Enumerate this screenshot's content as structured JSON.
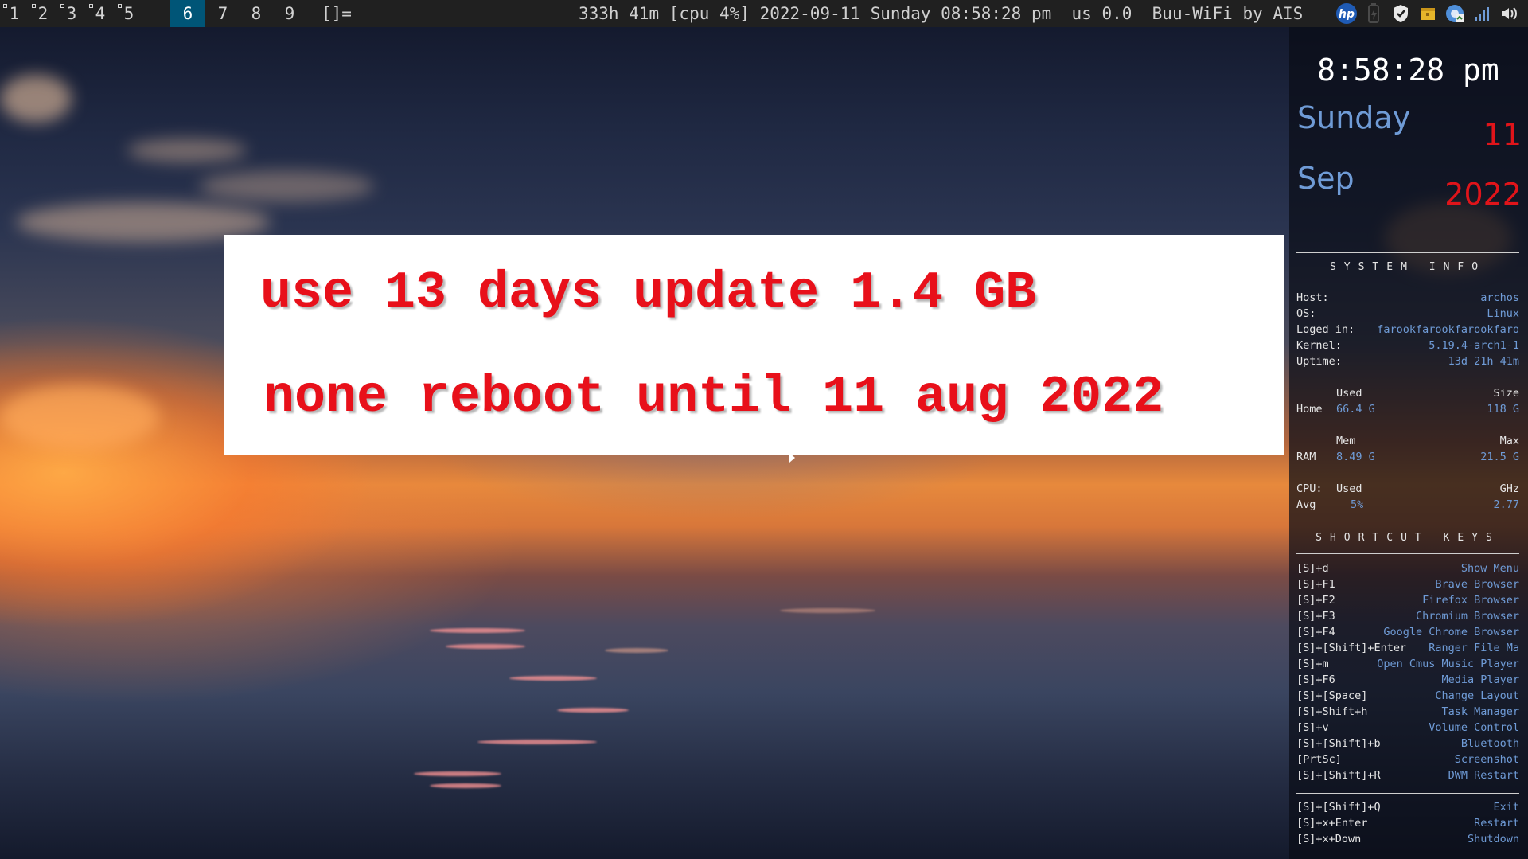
{
  "topbar": {
    "tags": [
      "1",
      "2",
      "3",
      "4",
      "5",
      "6",
      "7",
      "8",
      "9"
    ],
    "active_tag": "6",
    "layout_symbol": "[]=",
    "status_text": "333h 41m [cpu 4%] 2022-09-11 Sunday 08:58:28 pm  us 0.0  Buu-WiFi by AIS",
    "tray_icons": [
      "hp-icon",
      "battery-icon",
      "shield-icon",
      "package-icon",
      "chrome-update-icon",
      "signal-icon",
      "volume-icon"
    ],
    "hp_label": "hp"
  },
  "notice": {
    "line1": "use 13 days update 1.4 GB",
    "line2": "none reboot until 11 aug 2022"
  },
  "conky": {
    "clock": "8:58:28 pm",
    "day_name": "Sunday",
    "day_num": "11",
    "month": "Sep",
    "year": "2022",
    "system_info_title": "SYSTEM  INFO",
    "host_label": "Host:",
    "host_value": "archos",
    "os_label": "OS:",
    "os_value": "Linux",
    "login_label": "Loged in:",
    "login_value": "farookfarookfarookfaro",
    "kernel_label": "Kernel:",
    "kernel_value": "5.19.4-arch1-1",
    "uptime_label": "Uptime:",
    "uptime_value": "13d 21h 41m",
    "disk_used_header": "Used",
    "disk_size_header": "Size",
    "home_label": "Home",
    "home_used": "66.4 G",
    "home_size": "118 G",
    "mem_header": "Mem",
    "max_header": "Max",
    "ram_label": "RAM",
    "ram_used": "8.49 G",
    "ram_max": "21.5 G",
    "cpu_label": "CPU:",
    "cpu_used_header": "Used",
    "cpu_ghz_header": "GHz",
    "avg_label": "Avg",
    "cpu_used": "5%",
    "cpu_ghz": "2.77",
    "shortcut_title": "SHORTCUT  KEYS",
    "shortcuts": [
      {
        "key": "[S]+d",
        "action": "Show Menu"
      },
      {
        "key": "[S]+F1",
        "action": "Brave Browser"
      },
      {
        "key": "[S]+F2",
        "action": "Firefox Browser"
      },
      {
        "key": "[S]+F3",
        "action": "Chromium Browser"
      },
      {
        "key": "[S]+F4",
        "action": "Google Chrome Browser"
      },
      {
        "key": "[S]+[Shift]+Enter",
        "action": "Ranger File Ma"
      },
      {
        "key": "[S]+m",
        "action": "Open Cmus Music Player"
      },
      {
        "key": "[S]+F6",
        "action": "Media Player"
      },
      {
        "key": "[S]+[Space]",
        "action": "Change Layout"
      },
      {
        "key": "[S]+Shift+h",
        "action": "Task Manager"
      },
      {
        "key": "[S]+v",
        "action": "Volume Control"
      },
      {
        "key": "[S]+[Shift]+b",
        "action": "Bluetooth"
      },
      {
        "key": "[PrtSc]",
        "action": "Screenshot"
      },
      {
        "key": "[S]+[Shift]+R",
        "action": "DWM Restart"
      }
    ],
    "power_keys": [
      {
        "key": "[S]+[Shift]+Q",
        "action": "Exit"
      },
      {
        "key": "[S]+x+Enter",
        "action": "Restart"
      },
      {
        "key": "[S]+x+Down",
        "action": "Shutdown"
      }
    ]
  }
}
